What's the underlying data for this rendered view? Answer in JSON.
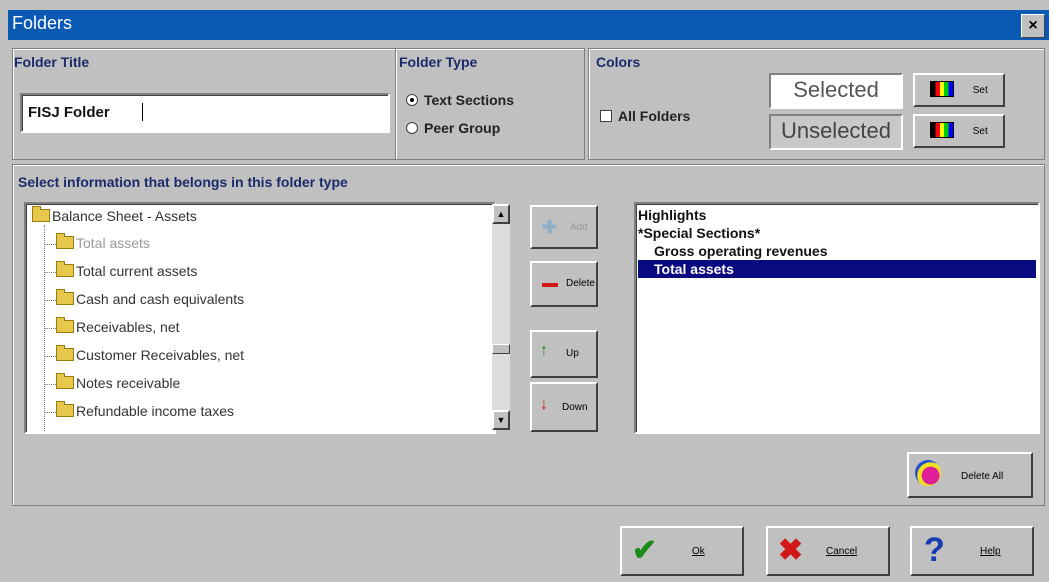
{
  "window": {
    "title": "Folders",
    "close_glyph": "×"
  },
  "folder_title": {
    "label": "Folder Title",
    "value": "FISJ Folder"
  },
  "folder_type": {
    "label": "Folder Type",
    "options": [
      "Text Sections",
      "Peer Group"
    ],
    "selected": "Text Sections"
  },
  "colors": {
    "label": "Colors",
    "all_folders_label": "All Folders",
    "selected_label": "Selected",
    "unselected_label": "Unselected",
    "set_label": "Set"
  },
  "select_info_label": "Select information that belongs in this folder type",
  "tree": {
    "root": "Balance Sheet - Assets",
    "items": [
      "Total assets",
      "Total current assets",
      "Cash and cash equivalents",
      "Receivables, net",
      "Customer Receivables, net",
      "Notes receivable",
      "Refundable income taxes"
    ]
  },
  "middle_buttons": {
    "add": "Add",
    "delete": "Delete",
    "up": "Up",
    "down": "Down"
  },
  "right_list": [
    "Highlights",
    "*Special Sections*",
    "Gross operating revenues",
    "Total assets"
  ],
  "delete_all_label": "Delete All",
  "bottom_buttons": {
    "ok": "Ok",
    "cancel": "Cancel",
    "help": "Help"
  },
  "colors_hex": {
    "title_bar": "#0a5ab4",
    "selection": "#0a0a80",
    "label": "#1a2a6a"
  }
}
